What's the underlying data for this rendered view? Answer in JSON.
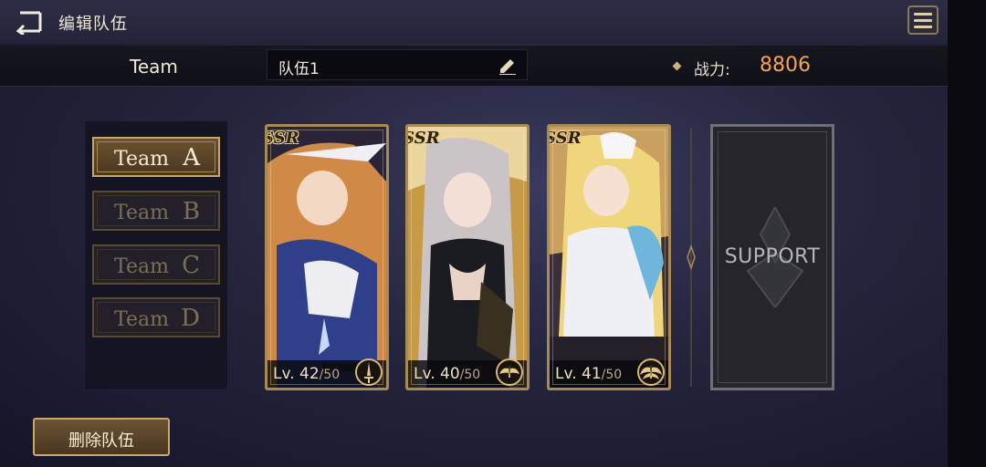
{
  "header": {
    "title": "编辑队伍",
    "back_icon": "back-arrow-icon",
    "menu_icon": "hamburger-menu-icon"
  },
  "info": {
    "team_label": "Team",
    "team_name": "队伍1",
    "edit_icon": "pencil-icon",
    "power_label": "战力:",
    "power_value": "8806"
  },
  "teams": [
    {
      "label": "Team",
      "letter": "A",
      "active": true
    },
    {
      "label": "Team",
      "letter": "B",
      "active": false
    },
    {
      "label": "Team",
      "letter": "C",
      "active": false
    },
    {
      "label": "Team",
      "letter": "D",
      "active": false
    }
  ],
  "heroes": [
    {
      "rarity": "SSR",
      "level_prefix": "Lv.",
      "level": "42",
      "max": "/50",
      "class_icon": "sword-class-icon"
    },
    {
      "rarity": "SSR",
      "level_prefix": "Lv.",
      "level": "40",
      "max": "/50",
      "class_icon": "wings-class-icon"
    },
    {
      "rarity": "SSR",
      "level_prefix": "Lv.",
      "level": "41",
      "max": "/50",
      "class_icon": "wings-class-icon"
    }
  ],
  "support": {
    "label": "SUPPORT"
  },
  "actions": {
    "delete_label": "删除队伍"
  },
  "colors": {
    "accent_gold": "#c9a86b",
    "power_orange": "#f5a352",
    "active_tab": "#6d5230"
  }
}
